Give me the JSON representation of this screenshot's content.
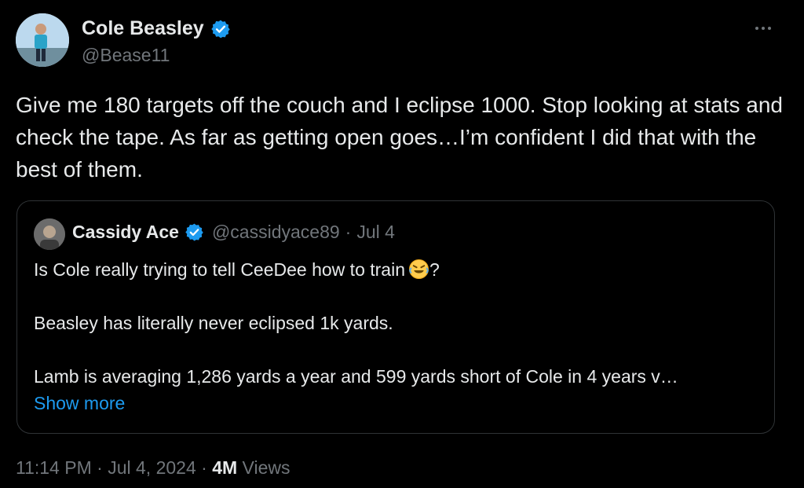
{
  "author": {
    "name": "Cole Beasley",
    "handle": "@Bease11"
  },
  "tweet": {
    "text": "Give me 180 targets off the couch and I eclipse 1000. Stop looking at stats and check the tape. As far as getting open goes…I’m confident I did that with the best of them."
  },
  "quote": {
    "name": "Cassidy Ace",
    "handle": "@cassidyace89",
    "separator": "·",
    "date": "Jul 4",
    "line1": "Is Cole really trying to tell CeeDee how to train",
    "line1_suffix": "?",
    "line2": "Beasley has literally never eclipsed 1k yards.",
    "line3": "Lamb is averaging 1,286 yards a year and 599 yards short of Cole in 4 years v…",
    "show_more": "Show more"
  },
  "meta": {
    "time": "11:14 PM",
    "separator": "·",
    "date": "Jul 4, 2024",
    "views_count": "4M",
    "views_label": "Views"
  },
  "icons": {
    "verified": "verified-badge-icon",
    "more": "more-options-icon",
    "emoji": "rolling-on-floor-laughing-emoji"
  },
  "colors": {
    "background": "#000000",
    "primary_text": "#e7e9ea",
    "secondary_text": "#71767b",
    "accent": "#1d9bf0",
    "border": "#2f3336"
  }
}
